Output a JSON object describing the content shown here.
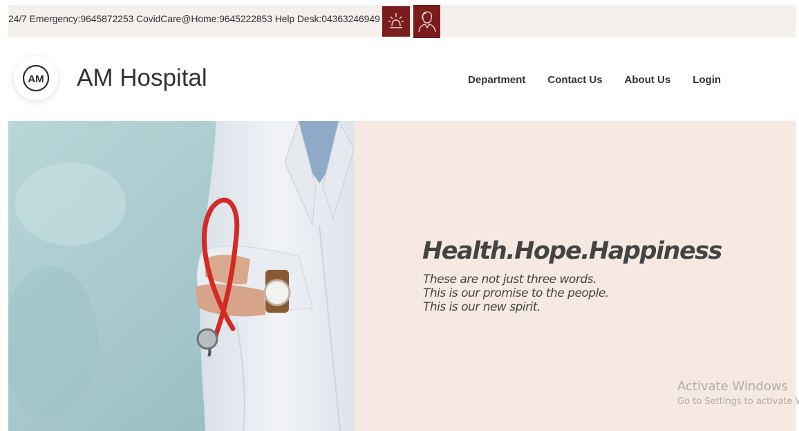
{
  "topbar": {
    "contact_text": "24/7 Emergency:9645872253 CovidCare@Home:9645222853 Help Desk:04363246949",
    "emergency_icon": "siren-icon",
    "doctor_icon": "doctor-icon",
    "accent_color": "#7a1c1c",
    "background_color": "#f6f0ed"
  },
  "header": {
    "logo_text": "AM",
    "brand": "AM Hospital",
    "nav": [
      "Department",
      "Contact Us",
      "About Us",
      "Login"
    ]
  },
  "hero": {
    "image_icon": "doctor-photo",
    "tagline": "Health.Hope.Happiness",
    "lines": [
      "These are not just three words.",
      "This is our promise to the people.",
      "This is our new spirit."
    ],
    "panel_color": "#f5e9e1"
  },
  "watermark": {
    "title": "Activate Windows",
    "subtitle": "Go to Settings to activate Windows."
  }
}
